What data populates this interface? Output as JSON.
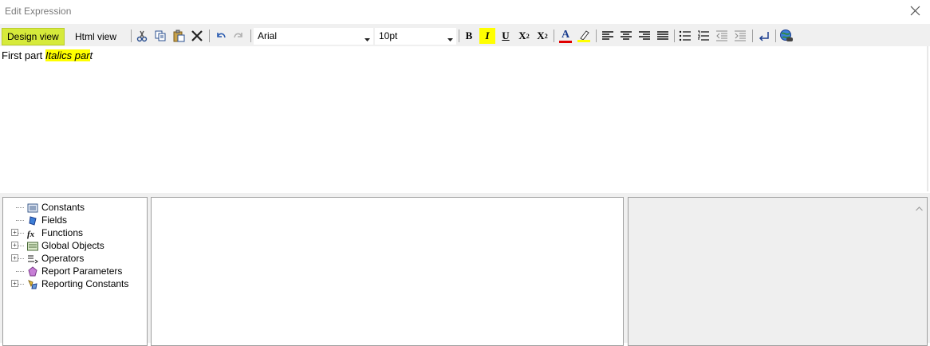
{
  "window": {
    "title": "Edit Expression"
  },
  "tabs": [
    {
      "label": "Design view"
    },
    {
      "label": "Html view"
    }
  ],
  "toolbar": {
    "font": "Arial",
    "size": "10pt",
    "bold": "B",
    "italic": "I",
    "underline": "U",
    "subscript": "X",
    "subscript_mark": "2",
    "superscript": "X",
    "superscript_mark": "2",
    "font_color_letter": "A",
    "accent": "#d6ea3b"
  },
  "editor": {
    "plain_text": "First part ",
    "highlighted_text": "Italics par",
    "tail_text": "t"
  },
  "tree": {
    "items": [
      {
        "label": "Constants",
        "icon": "constants-icon",
        "expandable": false
      },
      {
        "label": "Fields",
        "icon": "fields-icon",
        "expandable": false
      },
      {
        "label": "Functions",
        "icon": "function-icon",
        "expandable": true
      },
      {
        "label": "Global Objects",
        "icon": "global-objects-icon",
        "expandable": true
      },
      {
        "label": "Operators",
        "icon": "operators-icon",
        "expandable": true
      },
      {
        "label": "Report Parameters",
        "icon": "parameter-icon",
        "expandable": false
      },
      {
        "label": "Reporting Constants",
        "icon": "reporting-constants-icon",
        "expandable": true
      }
    ]
  }
}
